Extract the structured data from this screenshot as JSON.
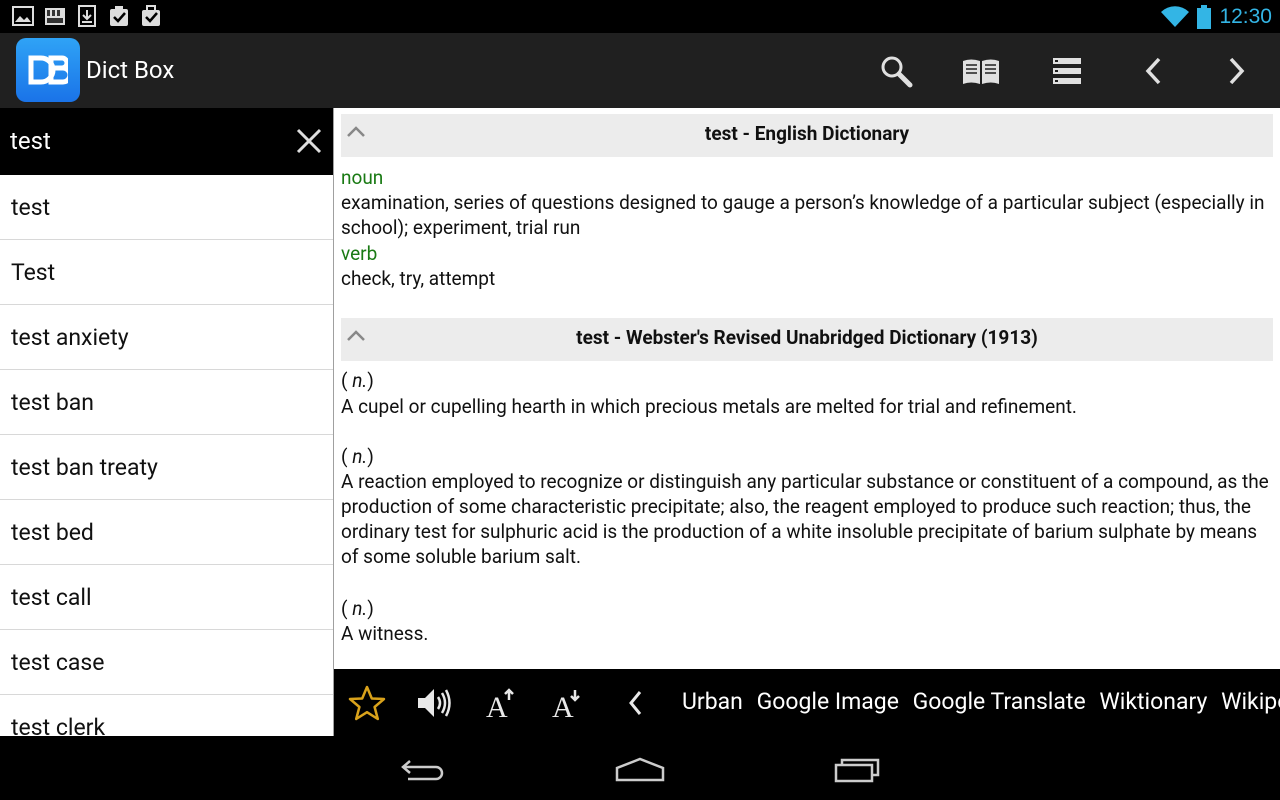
{
  "status_bar": {
    "time": "12:30",
    "left_icons": [
      "image-icon",
      "bookshelf-icon",
      "download-icon",
      "clipboard-check-icon",
      "briefcase-check-icon"
    ],
    "right_icons": [
      "wifi-icon",
      "battery-icon"
    ],
    "time_color": "#33b5e5"
  },
  "action_bar": {
    "app_name": "Dict Box",
    "actions": [
      "search-icon",
      "book-icon",
      "list-icon",
      "back-icon",
      "forward-icon"
    ]
  },
  "search": {
    "value": "test"
  },
  "word_list": [
    "test",
    "Test",
    "test anxiety",
    "test ban",
    "test ban treaty",
    "test bed",
    "test call",
    "test case",
    "test clerk"
  ],
  "entries": {
    "english": {
      "title": "test - English Dictionary",
      "noun_label": "noun",
      "noun_def": "examination, series of questions designed to gauge a person’s knowledge of a particular subject (especially in school); experiment, trial run",
      "verb_label": "verb",
      "verb_def": "check, try, attempt"
    },
    "webster": {
      "title": "test - Webster's Revised Unabridged Dictionary (1913)",
      "defs": [
        {
          "pos": "n.",
          "text": "A cupel or cupelling hearth in which precious metals are melted for trial and refinement."
        },
        {
          "pos": "n.",
          "text": "A reaction employed to recognize or distinguish any particular substance or constituent of a compound, as the production of some characteristic precipitate; also, the reagent employed to produce such reaction; thus, the ordinary test for sulphuric acid is the production of a white insoluble precipitate of barium sulphate by means of some soluble barium salt."
        },
        {
          "pos": "n.",
          "text": "A witness."
        }
      ]
    }
  },
  "bottom_bar": {
    "icons": [
      "star-icon",
      "speaker-icon",
      "font-increase-icon",
      "font-decrease-icon",
      "chevron-left-icon"
    ],
    "links": [
      "Urban",
      "Google Image",
      "Google Translate",
      "Wiktionary",
      "Wikipedia"
    ]
  },
  "nav_bar": {
    "buttons": [
      "back-nav-icon",
      "home-nav-icon",
      "recents-nav-icon"
    ]
  },
  "colors": {
    "pos_green": "#1a7a14",
    "header_gray": "#ececec",
    "app_icon_blue": "#1a73e8",
    "star_gold": "#d9a21b"
  }
}
